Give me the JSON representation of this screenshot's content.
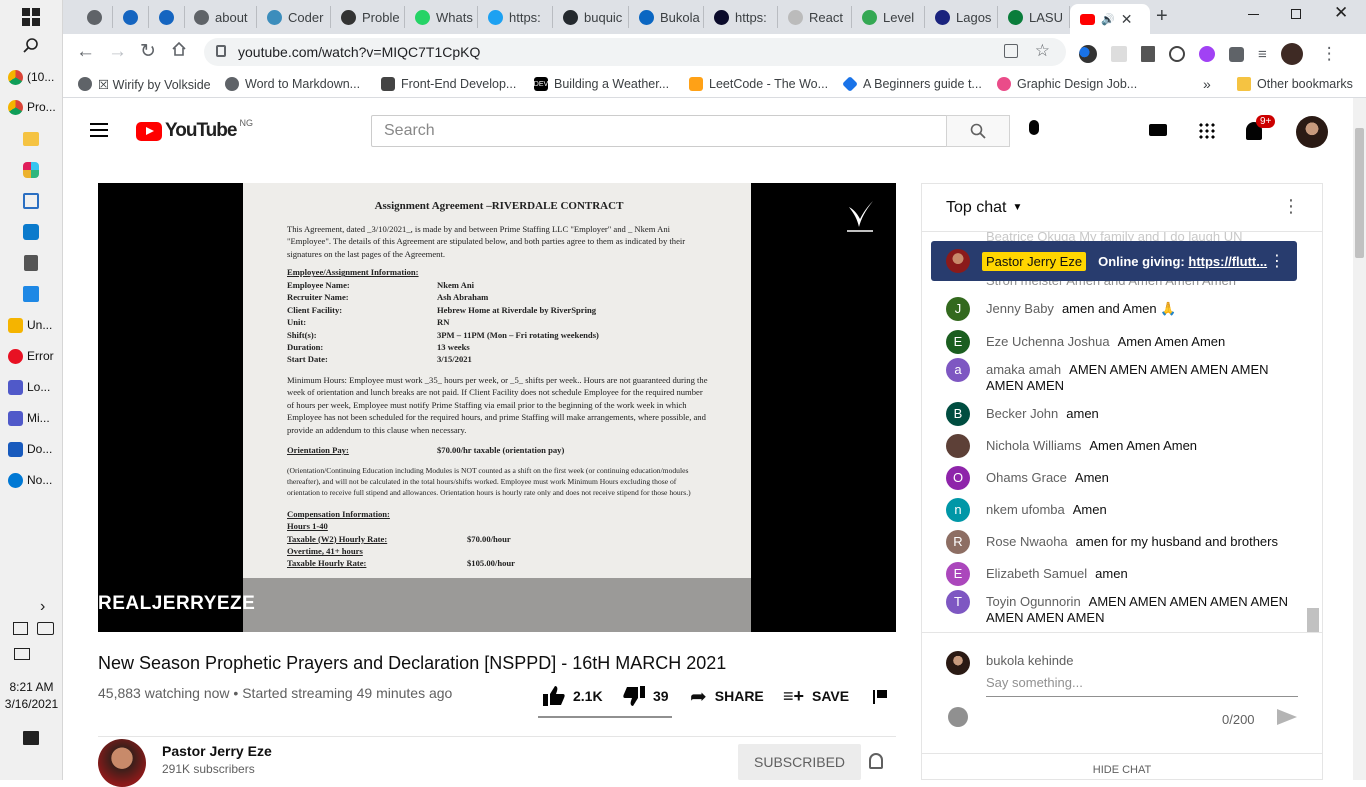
{
  "taskbar": {
    "time": "8:21 AM",
    "date": "3/16/2021",
    "items": [
      {
        "label": "(10...",
        "color": "#e44134"
      },
      {
        "label": "Pro...",
        "color": "#e44134"
      },
      {
        "label": "Un...",
        "color": "#f5b400"
      },
      {
        "label": "Error",
        "color": "#e81123"
      },
      {
        "label": "Lo...",
        "color": "#5059c9"
      },
      {
        "label": "Mi...",
        "color": "#5059c9"
      },
      {
        "label": "Do...",
        "color": "#185abd"
      },
      {
        "label": "No...",
        "color": "#0078d4"
      }
    ]
  },
  "browser": {
    "tabs": [
      {
        "label": "",
        "color": "#5f6368"
      },
      {
        "label": "",
        "color": "#1565c0"
      },
      {
        "label": "",
        "color": "#1565c0"
      },
      {
        "label": "about",
        "color": "#5f6368"
      },
      {
        "label": "Coder",
        "color": "#3c8dbc"
      },
      {
        "label": "Proble",
        "color": "#333333"
      },
      {
        "label": "Whats",
        "color": "#25d366"
      },
      {
        "label": "https:",
        "color": "#1da1f2"
      },
      {
        "label": "buquic",
        "color": "#24292e"
      },
      {
        "label": "Bukola",
        "color": "#0a66c2"
      },
      {
        "label": "https:",
        "color": "#0b0b2b"
      },
      {
        "label": "React",
        "color": "#bbbbbb"
      },
      {
        "label": "Level",
        "color": "#34a853"
      },
      {
        "label": "Lagos",
        "color": "#1a237e"
      },
      {
        "label": "LASU",
        "color": "#0a7d3b"
      }
    ],
    "url": "youtube.com/watch?v=MIQC7T1CpKQ",
    "bookmarks": [
      "☒ Wirify by Volkside",
      "Word to Markdown...",
      "Front-End Develop...",
      "Building a Weather...",
      "LeetCode - The Wo...",
      "A Beginners guide t...",
      "Graphic Design Job..."
    ],
    "other_bookmarks": "Other bookmarks"
  },
  "youtube": {
    "logo": "YouTube",
    "region": "NG",
    "search_placeholder": "Search",
    "notif_count": "9+",
    "video": {
      "title": "New Season Prophetic Prayers and Declaration [NSPPD] - 16tH MARCH 2021",
      "meta": "45,883 watching now • Started streaming 49 minutes ago",
      "watermark": "REALJERRYEZE",
      "likes": "2.1K",
      "dislikes": "39",
      "share": "SHARE",
      "save": "SAVE",
      "channel": "Pastor Jerry Eze",
      "subscribers": "291K subscribers",
      "subscribed": "SUBSCRIBED"
    },
    "document": {
      "title": "Assignment Agreement –RIVERDALE CONTRACT",
      "intro": "This Agreement, dated _3/10/2021_, is made by and between Prime Staffing LLC \"Employer\" and _ Nkem Ani \"Employee\". The details of this Agreement are stipulated below, and both parties agree to them as indicated by their signatures on the last pages of the Agreement.",
      "section1": "Employee/Assignment Information:",
      "fields": [
        {
          "k": "Employee Name:",
          "v": "Nkem Ani"
        },
        {
          "k": "Recruiter Name:",
          "v": "Ash Abraham"
        },
        {
          "k": "Client Facility:",
          "v": "Hebrew Home at Riverdale by RiverSpring"
        },
        {
          "k": "Unit:",
          "v": "RN"
        },
        {
          "k": "Shift(s):",
          "v": "3PM – 11PM (Mon – Fri rotating weekends)"
        },
        {
          "k": "Duration:",
          "v": "13 weeks"
        },
        {
          "k": "Start Date:",
          "v": "3/15/2021"
        }
      ],
      "min_hours": "Minimum Hours: Employee must work _35_ hours per week, or _5_ shifts per week.. Hours are not guaranteed during the week of orientation and lunch breaks are not paid. If Client Facility does not schedule Employee for the required number of hours per week, Employee must notify Prime Staffing via email prior to the beginning of the work week in which Employee has not been scheduled for the required hours, and prime Staffing will make arrangements, where possible, and provide an addendum to this clause when necessary.",
      "orientation_label": "Orientation Pay:",
      "orientation_value": "$70.00/hr taxable (orientation pay)",
      "orientation_note": "(Orientation/Continuing Education including Modules is NOT counted as a shift on the first week (or continuing education/modules thereafter), and will not be calculated in the total hours/shifts worked. Employee must work Minimum Hours excluding those of orientation to receive full stipend and allowances. Orientation hours is hourly rate only and does not receive stipend for those hours.)",
      "section2": "Compensation Information:",
      "comp": [
        {
          "k": "Hours 1-40",
          "v": ""
        },
        {
          "k": "Taxable (W2) Hourly Rate:",
          "v": "$70.00/hour"
        },
        {
          "k": "Overtime, 41+ hours",
          "v": ""
        },
        {
          "k": "Taxable Hourly Rate:",
          "v": "$105.00/hour"
        }
      ]
    },
    "chat": {
      "header": "Top chat",
      "pinned_author": "Pastor Jerry Eze",
      "pinned_text": "Online giving:",
      "pinned_link": "https://flutt...",
      "faded_top": "Beatrice Okuga   My family and I do laugh UN",
      "faded_second": "Stron meister   Amen and Amen Amen Amen",
      "messages": [
        {
          "author": "Jenny Baby",
          "text": "amen and Amen 🙏",
          "initial": "J",
          "color": "#33691e"
        },
        {
          "author": "Eze Uchenna Joshua",
          "text": "Amen Amen Amen",
          "initial": "E",
          "color": "#1b5e20"
        },
        {
          "author": "amaka amah",
          "text": "AMEN AMEN AMEN AMEN AMEN AMEN AMEN",
          "initial": "a",
          "color": "#7e57c2"
        },
        {
          "author": "Becker John",
          "text": "amen",
          "initial": "B",
          "color": "#004d40"
        },
        {
          "author": "Nichola Williams",
          "text": "Amen Amen Amen",
          "initial": "",
          "color": "#5d4037"
        },
        {
          "author": "Ohams Grace",
          "text": "Amen",
          "initial": "O",
          "color": "#8e24aa"
        },
        {
          "author": "nkem ufomba",
          "text": "Amen",
          "initial": "n",
          "color": "#0097a7"
        },
        {
          "author": "Rose Nwaoha",
          "text": "amen for my husband and brothers",
          "initial": "R",
          "color": "#8d6e63"
        },
        {
          "author": "Elizabeth Samuel",
          "text": "amen",
          "initial": "E",
          "color": "#ab47bc"
        },
        {
          "author": "Toyin Ogunnorin",
          "text": "AMEN AMEN AMEN AMEN AMEN AMEN AMEN AMEN",
          "initial": "T",
          "color": "#7e57c2"
        }
      ],
      "user": "bukola kehinde",
      "input_placeholder": "Say something...",
      "counter": "0/200",
      "hide": "HIDE CHAT"
    }
  }
}
